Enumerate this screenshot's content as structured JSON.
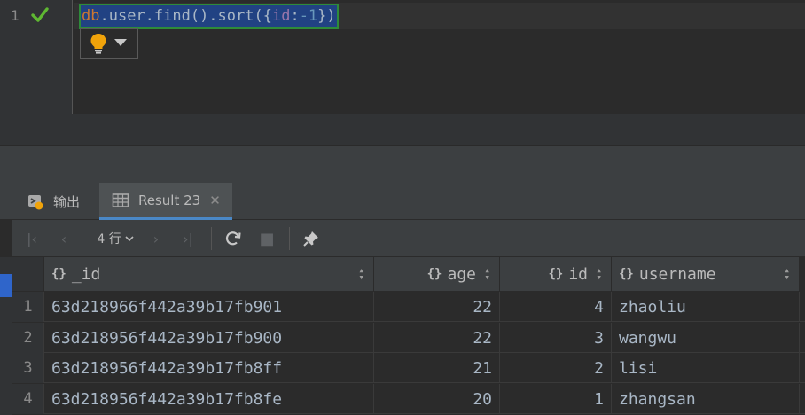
{
  "editor": {
    "line_number": "1",
    "code_parts": [
      "db",
      ".user.find().sort({",
      "id",
      ":",
      "-1",
      "})"
    ]
  },
  "tabs": {
    "output_label": "输出",
    "result_label": "Result 23",
    "close_glyph": "✕"
  },
  "toolbar": {
    "first_glyph": "|‹",
    "prev_glyph": "‹",
    "rows_label": "4 行",
    "next_glyph": "›",
    "last_glyph": "›|",
    "refresh_glyph": "⟳",
    "stop_glyph": "■",
    "pin_glyph": "📌"
  },
  "table": {
    "columns": [
      {
        "label": "_id"
      },
      {
        "label": "age"
      },
      {
        "label": "id"
      },
      {
        "label": "username"
      }
    ],
    "rows": [
      {
        "num": "1",
        "_id": "63d218966f442a39b17fb901",
        "age": "22",
        "id": "4",
        "username": "zhaoliu"
      },
      {
        "num": "2",
        "_id": "63d218956f442a39b17fb900",
        "age": "22",
        "id": "3",
        "username": "wangwu"
      },
      {
        "num": "3",
        "_id": "63d218956f442a39b17fb8ff",
        "age": "21",
        "id": "2",
        "username": "lisi"
      },
      {
        "num": "4",
        "_id": "63d218956f442a39b17fb8fe",
        "age": "20",
        "id": "1",
        "username": "zhangsan"
      }
    ]
  },
  "colors": {
    "accent_blue": "#4a88c7",
    "selection": "#214283",
    "success_green": "#5fb832",
    "bulb_orange": "#f0a30a"
  },
  "icons": [
    "check-icon",
    "lightbulb-icon",
    "output-icon",
    "table-icon",
    "refresh-icon",
    "stop-icon",
    "pin-icon"
  ]
}
